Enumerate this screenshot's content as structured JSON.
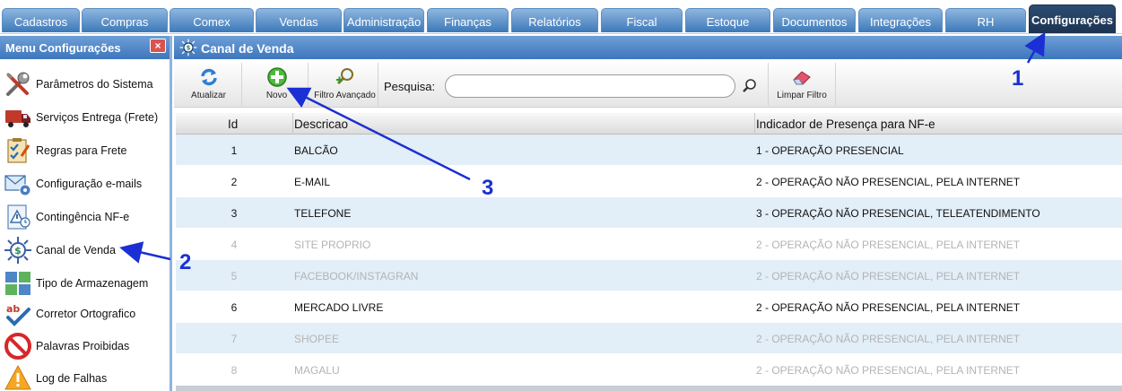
{
  "tabs": [
    {
      "label": "Cadastros"
    },
    {
      "label": "Compras"
    },
    {
      "label": "Comex"
    },
    {
      "label": "Vendas"
    },
    {
      "label": "Administração"
    },
    {
      "label": "Finanças"
    },
    {
      "label": "Relatórios"
    },
    {
      "label": "Fiscal"
    },
    {
      "label": "Estoque"
    },
    {
      "label": "Documentos"
    },
    {
      "label": "Integrações"
    },
    {
      "label": "RH"
    },
    {
      "label": "Configurações",
      "active": true
    }
  ],
  "sidebar": {
    "title": "Menu Configurações",
    "close_label": "×",
    "items": [
      {
        "label": "Parâmetros do Sistema",
        "icon": "tools-icon"
      },
      {
        "label": "Serviços Entrega (Frete)",
        "icon": "truck-icon"
      },
      {
        "label": "Regras para Frete",
        "icon": "checklist-icon"
      },
      {
        "label": "Configuração e-mails",
        "icon": "email-gear-icon"
      },
      {
        "label": "Contingência NF-e",
        "icon": "document-warning-icon"
      },
      {
        "label": "Canal de Venda",
        "icon": "sales-channel-icon"
      },
      {
        "label": "Tipo de Armazenagem",
        "icon": "storage-grid-icon"
      },
      {
        "label": "Corretor Ortografico",
        "icon": "spellcheck-icon"
      },
      {
        "label": "Palavras Proibidas",
        "icon": "forbidden-icon"
      },
      {
        "label": "Log de Falhas",
        "icon": "warning-icon"
      }
    ]
  },
  "panel": {
    "title": "Canal de Venda",
    "toolbar": {
      "refresh_label": "Atualizar",
      "new_label": "Novo",
      "advanced_filter_label": "Filtro Avançado",
      "search_label": "Pesquisa:",
      "search_value": "",
      "clear_filter_label": "Limpar Filtro"
    }
  },
  "grid": {
    "columns": [
      "Id",
      "Descricao",
      "Indicador de Presença para NF-e"
    ],
    "rows": [
      {
        "id": "1",
        "descricao": "BALCÃO",
        "indicador": "1 - OPERAÇÃO PRESENCIAL",
        "active": true
      },
      {
        "id": "2",
        "descricao": "E-MAIL",
        "indicador": "2 - OPERAÇÃO NÃO PRESENCIAL, PELA INTERNET",
        "active": true
      },
      {
        "id": "3",
        "descricao": "TELEFONE",
        "indicador": "3 - OPERAÇÃO NÃO PRESENCIAL, TELEATENDIMENTO",
        "active": true
      },
      {
        "id": "4",
        "descricao": "SITE PROPRIO",
        "indicador": "2 - OPERAÇÃO NÃO PRESENCIAL, PELA INTERNET",
        "active": false
      },
      {
        "id": "5",
        "descricao": "FACEBOOK/INSTAGRAN",
        "indicador": "2 - OPERAÇÃO NÃO PRESENCIAL, PELA INTERNET",
        "active": false
      },
      {
        "id": "6",
        "descricao": "MERCADO LIVRE",
        "indicador": "2 - OPERAÇÃO NÃO PRESENCIAL, PELA INTERNET",
        "active": true
      },
      {
        "id": "7",
        "descricao": "SHOPEE",
        "indicador": "2 - OPERAÇÃO NÃO PRESENCIAL, PELA INTERNET",
        "active": false
      },
      {
        "id": "8",
        "descricao": "MAGALU",
        "indicador": "2 - OPERAÇÃO NÃO PRESENCIAL, PELA INTERNET",
        "active": false
      }
    ]
  },
  "annotations": [
    {
      "label": "1"
    },
    {
      "label": "2"
    },
    {
      "label": "3"
    }
  ],
  "colors": {
    "tab": "#3b78b8",
    "tab_active": "#1c3350",
    "header": "#3d76bd",
    "row_alt": "#e2eef8",
    "inactive_text": "#b4b4b4",
    "annotation": "#1a2fd4"
  }
}
